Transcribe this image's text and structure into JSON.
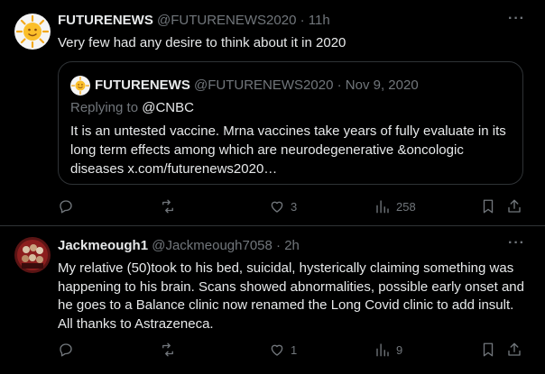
{
  "tweets": [
    {
      "name": "FUTURENEWS",
      "handle": "@FUTURENEWS2020",
      "time": "· 11h",
      "more": "···",
      "text": "Very few had any desire to think about it in 2020",
      "quote": {
        "name": "FUTURENEWS",
        "handle": "@FUTURENEWS2020",
        "time": "· Nov 9, 2020",
        "reply_prefix": "Replying to ",
        "reply_mention": "@CNBC",
        "text": "It is an untested vaccine. Mrna vaccines take years of fully evaluate in its long term effects among which are neurodegenerative &oncologic diseases x.com/futurenews2020…"
      },
      "actions": {
        "reply": "",
        "retweet": "",
        "like": "3",
        "views": "258"
      }
    },
    {
      "name": "Jackmeough1",
      "handle": "@Jackmeough7058",
      "time": "· 2h",
      "more": "···",
      "text": "My relative (50)took to his bed, suicidal, hysterically claiming something was happening to his brain. Scans showed abnormalities, possible early onset and he goes to a Balance clinic now renamed the Long Covid clinic to add insult. All thanks to Astrazeneca.",
      "actions": {
        "reply": "",
        "retweet": "",
        "like": "1",
        "views": "9"
      }
    }
  ],
  "icons": [
    "sun-avatar-icon",
    "reply-icon",
    "retweet-icon",
    "like-icon",
    "views-icon",
    "bookmark-icon",
    "share-icon"
  ],
  "colors": {
    "background": "#000000",
    "text": "#e7e9ea",
    "muted": "#71767b",
    "border": "#2f3336"
  }
}
